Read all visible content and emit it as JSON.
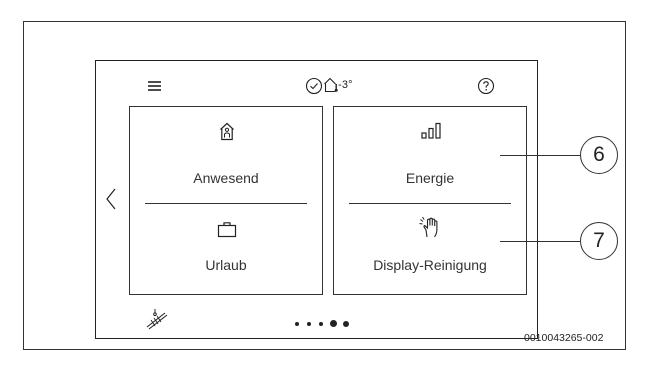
{
  "header": {
    "menu_icon": "hamburger-menu-icon",
    "status_icon": "check-circle-icon",
    "temperature_icon": "house-thermometer-icon",
    "temperature": "-3°",
    "help_icon": "question-circle-icon"
  },
  "navigation": {
    "back_icon": "chevron-left-icon"
  },
  "tiles": {
    "anwesend": {
      "label": "Anwesend",
      "icon": "home-person-icon"
    },
    "urlaub": {
      "label": "Urlaub",
      "icon": "suitcase-icon"
    },
    "energie": {
      "label": "Energie",
      "icon": "signal-bars-icon"
    },
    "display_reinigung": {
      "label": "Display-Reinigung",
      "icon": "hand-cleaning-icon"
    }
  },
  "footer": {
    "heat_pump_icon": "heat-pump-icon",
    "page_count": 5,
    "active_page": 4
  },
  "callouts": {
    "six": "6",
    "seven": "7"
  },
  "document_id": "0010043265-002"
}
